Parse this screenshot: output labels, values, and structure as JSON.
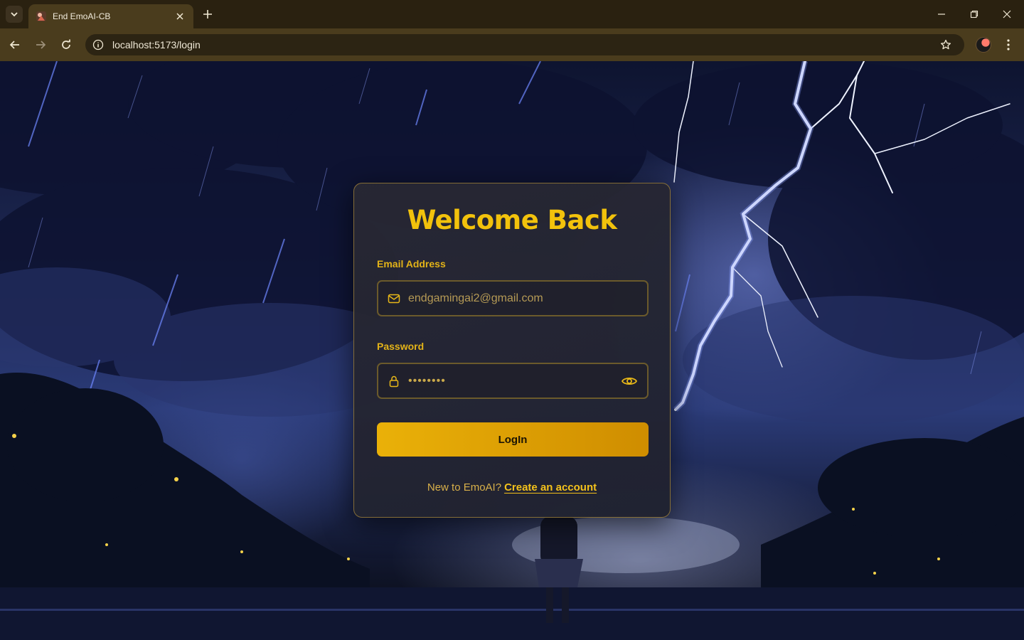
{
  "browser": {
    "tab_title": "End EmoAI-CB",
    "url": "localhost:5173/login",
    "icons": {
      "tab_search": "chevron-down-icon",
      "favicon": "app-favicon-icon",
      "tab_close": "close-icon",
      "new_tab": "plus-icon",
      "minimize": "minimize-icon",
      "restore": "restore-icon",
      "close_window": "close-icon",
      "back": "arrow-left-icon",
      "forward": "arrow-right-icon",
      "reload": "reload-icon",
      "site_info": "info-icon",
      "bookmark": "star-icon",
      "menu": "kebab-menu-icon"
    }
  },
  "login": {
    "title": "Welcome Back",
    "email": {
      "label": "Email Address",
      "value": "endgamingai2@gmail.com",
      "icon": "mail-icon"
    },
    "password": {
      "label": "Password",
      "value": "••••••••",
      "icon": "lock-icon",
      "toggle_icon": "eye-icon"
    },
    "login_button": "LogIn",
    "signup_prompt": "New to EmoAI?",
    "signup_link": "Create an account"
  },
  "colors": {
    "accent": "#f2c20c",
    "button_start": "#eab108",
    "button_end": "#cf8d00",
    "card_background": "#28283a",
    "chrome_toolbar": "#4a3c1d",
    "chrome_tabbar": "#2a2110"
  }
}
